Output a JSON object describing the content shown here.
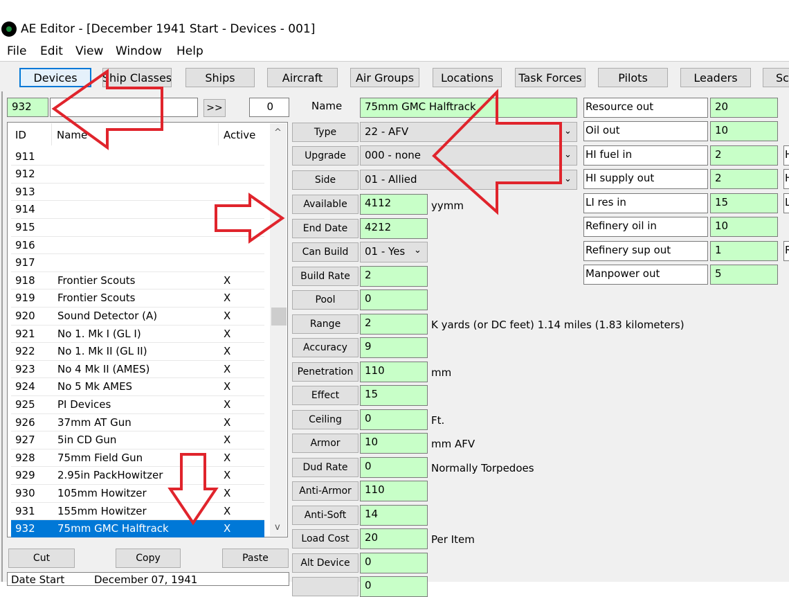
{
  "window": {
    "title": "AE Editor - [December 1941 Start - Devices - 001]"
  },
  "menu": [
    "File",
    "Edit",
    "View",
    "Window",
    "Help"
  ],
  "tabs": [
    "Devices",
    "Ship Classes",
    "Ships",
    "Aircraft",
    "Air Groups",
    "Locations",
    "Task Forces",
    "Pilots",
    "Leaders",
    "Sc"
  ],
  "search": {
    "id_value": "932",
    "text_value": "",
    "next_label": ">>",
    "count_value": "0"
  },
  "list": {
    "headers": {
      "id": "ID",
      "name": "Name",
      "active": "Active"
    },
    "rows": [
      {
        "id": "911",
        "name": "",
        "active": ""
      },
      {
        "id": "912",
        "name": "",
        "active": ""
      },
      {
        "id": "913",
        "name": "",
        "active": ""
      },
      {
        "id": "914",
        "name": "",
        "active": ""
      },
      {
        "id": "915",
        "name": "",
        "active": ""
      },
      {
        "id": "916",
        "name": "",
        "active": ""
      },
      {
        "id": "917",
        "name": "",
        "active": ""
      },
      {
        "id": "918",
        "name": "Frontier Scouts",
        "active": "X"
      },
      {
        "id": "919",
        "name": "Frontier Scouts",
        "active": "X"
      },
      {
        "id": "920",
        "name": "Sound Detector (A)",
        "active": "X"
      },
      {
        "id": "921",
        "name": "No 1. Mk I (GL I)",
        "active": "X"
      },
      {
        "id": "922",
        "name": "No 1. Mk II (GL II)",
        "active": "X"
      },
      {
        "id": "923",
        "name": "No 4 Mk II (AMES)",
        "active": "X"
      },
      {
        "id": "924",
        "name": "No 5 Mk AMES",
        "active": "X"
      },
      {
        "id": "925",
        "name": "PI Devices",
        "active": "X"
      },
      {
        "id": "926",
        "name": "37mm AT Gun",
        "active": "X"
      },
      {
        "id": "927",
        "name": "5in CD Gun",
        "active": "X"
      },
      {
        "id": "928",
        "name": "75mm Field Gun",
        "active": "X"
      },
      {
        "id": "929",
        "name": "2.95in PackHowitzer",
        "active": "X"
      },
      {
        "id": "930",
        "name": "105mm Howitzer",
        "active": "X"
      },
      {
        "id": "931",
        "name": "155mm Howitzer",
        "active": "X"
      },
      {
        "id": "932",
        "name": "75mm GMC Halftrack",
        "active": "X"
      }
    ],
    "scroll_up": "^",
    "scroll_down": "v"
  },
  "actions": {
    "cut": "Cut",
    "copy": "Copy",
    "paste": "Paste"
  },
  "footer": {
    "date_label": "Date Start",
    "date_value": "December 07, 1941"
  },
  "form": {
    "name_label": "Name",
    "name_value": "75mm GMC Halftrack",
    "type": {
      "label": "Type",
      "value": "22 - AFV"
    },
    "upgrade": {
      "label": "Upgrade",
      "value": "000 - none"
    },
    "side": {
      "label": "Side",
      "value": "01 - Allied"
    },
    "available": {
      "label": "Available",
      "value": "4112",
      "unit": "yymm"
    },
    "end_date": {
      "label": "End Date",
      "value": "4212"
    },
    "can_build": {
      "label": "Can Build",
      "value": "01 - Yes"
    },
    "build_rate": {
      "label": "Build Rate",
      "value": "2"
    },
    "pool": {
      "label": "Pool",
      "value": "0"
    },
    "range": {
      "label": "Range",
      "value": "2",
      "unit": "K yards  (or DC feet)  1.14 miles  (1.83 kilometers)"
    },
    "accuracy": {
      "label": "Accuracy",
      "value": "9"
    },
    "penetration": {
      "label": "Penetration",
      "value": "110",
      "unit": "mm"
    },
    "effect": {
      "label": "Effect",
      "value": "15"
    },
    "ceiling": {
      "label": "Ceiling",
      "value": "0",
      "unit": "Ft."
    },
    "armor": {
      "label": "Armor",
      "value": "10",
      "unit": "mm AFV"
    },
    "dud_rate": {
      "label": "Dud Rate",
      "value": "0",
      "unit": "Normally Torpedoes"
    },
    "anti_armor": {
      "label": "Anti-Armor",
      "value": "110"
    },
    "anti_soft": {
      "label": "Anti-Soft",
      "value": "14"
    },
    "load_cost": {
      "label": "Load Cost",
      "value": "20",
      "unit": "Per Item"
    },
    "alt_device": {
      "label": "Alt Device",
      "value": "0"
    },
    "last_value": "0"
  },
  "resources": [
    {
      "label": "Resource out",
      "value": "20"
    },
    {
      "label": "Oil out",
      "value": "10"
    },
    {
      "label": "HI fuel in",
      "value": "2",
      "edge": "H"
    },
    {
      "label": "HI supply out",
      "value": "2",
      "edge": "H"
    },
    {
      "label": "LI res in",
      "value": "15",
      "edge": "L"
    },
    {
      "label": "Refinery oil in",
      "value": "10"
    },
    {
      "label": "Refinery sup out",
      "value": "1",
      "edge": "R"
    },
    {
      "label": "Manpower out",
      "value": "5"
    }
  ],
  "colors": {
    "field_green": "#c8ffc8",
    "selection": "#0078d7",
    "annotation_red": "#e0242c"
  }
}
